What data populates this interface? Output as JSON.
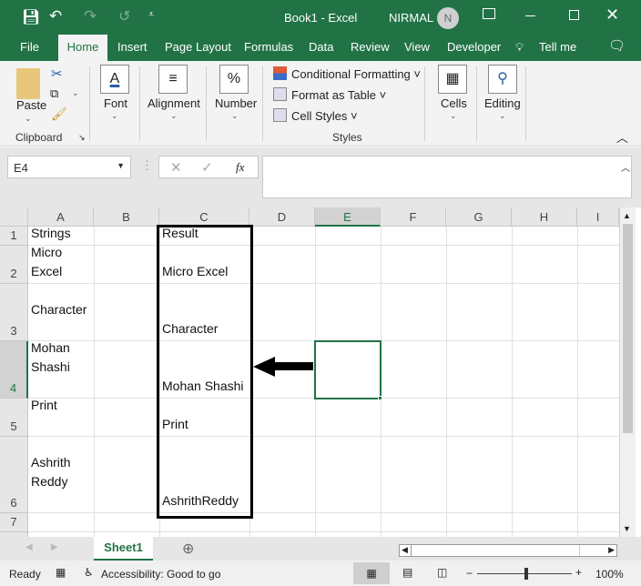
{
  "title_bar": {
    "doc_title": "Book1  -  Excel",
    "user_name": "NIRMAL",
    "avatar_initial": "N",
    "accent": "#217346"
  },
  "ribbon_tabs": [
    "File",
    "Home",
    "Insert",
    "Page Layout",
    "Formulas",
    "Data",
    "Review",
    "View",
    "Developer",
    "Tell me"
  ],
  "ribbon": {
    "clipboard": {
      "paste": "Paste",
      "group": "Clipboard"
    },
    "font": "Font",
    "alignment": "Alignment",
    "number": "Number",
    "styles": {
      "conditional": "Conditional Formatting",
      "format_table": "Format as Table",
      "cell_styles": "Cell Styles",
      "group": "Styles"
    },
    "cells": "Cells",
    "editing": "Editing"
  },
  "formula_bar": {
    "name_box": "E4",
    "fx": "fx",
    "value": ""
  },
  "columns": [
    "A",
    "B",
    "C",
    "D",
    "E",
    "F",
    "G",
    "H",
    "I"
  ],
  "rows": [
    "1",
    "2",
    "3",
    "4",
    "5",
    "6",
    "7"
  ],
  "cells": {
    "A1": "Strings",
    "A2": "Micro\nExcel",
    "A3": "Character",
    "A4": "Mohan\nShashi",
    "A5": "Print",
    "A6": "Ashrith\nReddy",
    "C1": "Result",
    "C2": "Micro Excel",
    "C3": "Character",
    "C4": "Mohan Shashi",
    "C5": "Print",
    "C6": "AshrithReddy"
  },
  "selected_cell": "E4",
  "sheet_tabs": [
    "Sheet1"
  ],
  "status": {
    "ready": "Ready",
    "accessibility": "Accessibility: Good to go",
    "zoom": "100%",
    "zoom_minus": "−",
    "zoom_plus": "+"
  }
}
